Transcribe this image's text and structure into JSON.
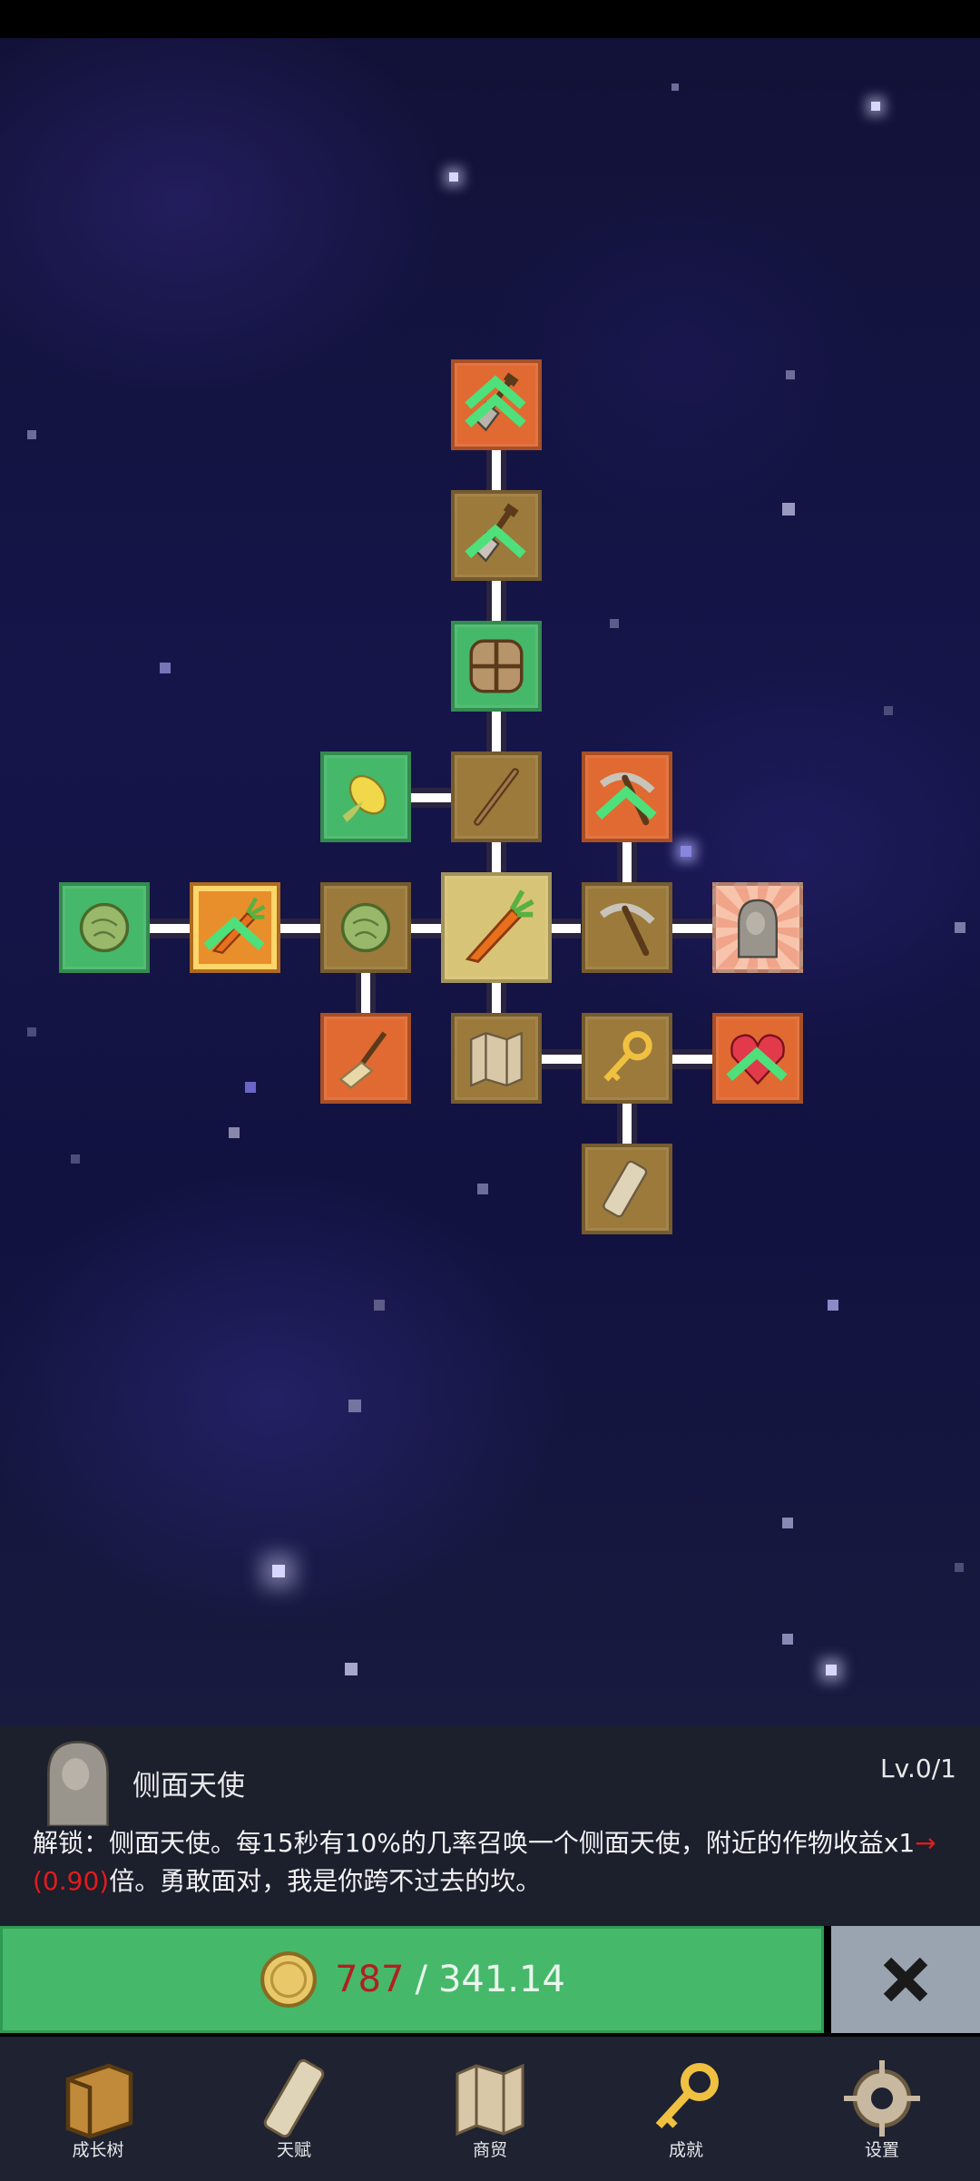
{
  "info": {
    "name": "侧面天使",
    "level": "Lv.0/1",
    "desc_prefix": "解锁：侧面天使。每15秒有10%的几率召唤一个侧面天使，附近的作物收益x1",
    "desc_arrow": "→",
    "desc_value": "(0.90)",
    "desc_suffix": "倍。勇敢面对，我是你跨不过去的坎。"
  },
  "cost": {
    "current": "787",
    "separator": "/",
    "required": "341.14"
  },
  "nav": {
    "items": [
      {
        "label": "成长树",
        "icon": "book-icon"
      },
      {
        "label": "天赋",
        "icon": "scroll-icon"
      },
      {
        "label": "商贸",
        "icon": "map-icon"
      },
      {
        "label": "成就",
        "icon": "key-icon"
      },
      {
        "label": "设置",
        "icon": "gear-icon"
      }
    ]
  },
  "tree_nodes": [
    {
      "icon": "shovel-icon",
      "color": "orange"
    },
    {
      "icon": "shovel-icon",
      "color": "gold"
    },
    {
      "icon": "backpack-icon",
      "color": "green"
    },
    {
      "icon": "corn-icon",
      "color": "green"
    },
    {
      "icon": "stick-icon",
      "color": "gold"
    },
    {
      "icon": "pickaxe-icon",
      "color": "orange"
    },
    {
      "icon": "cabbage-icon",
      "color": "green"
    },
    {
      "icon": "carrot-icon",
      "color": "orange-highlight"
    },
    {
      "icon": "cabbage-icon",
      "color": "gold"
    },
    {
      "icon": "carrot-icon",
      "color": "center"
    },
    {
      "icon": "pickaxe-icon",
      "color": "gold"
    },
    {
      "icon": "angel-statue-icon",
      "color": "pink"
    },
    {
      "icon": "broom-icon",
      "color": "orange"
    },
    {
      "icon": "map-icon",
      "color": "gold"
    },
    {
      "icon": "key-icon",
      "color": "gold"
    },
    {
      "icon": "heart-icon",
      "color": "orange"
    },
    {
      "icon": "scroll-icon",
      "color": "gold"
    }
  ]
}
